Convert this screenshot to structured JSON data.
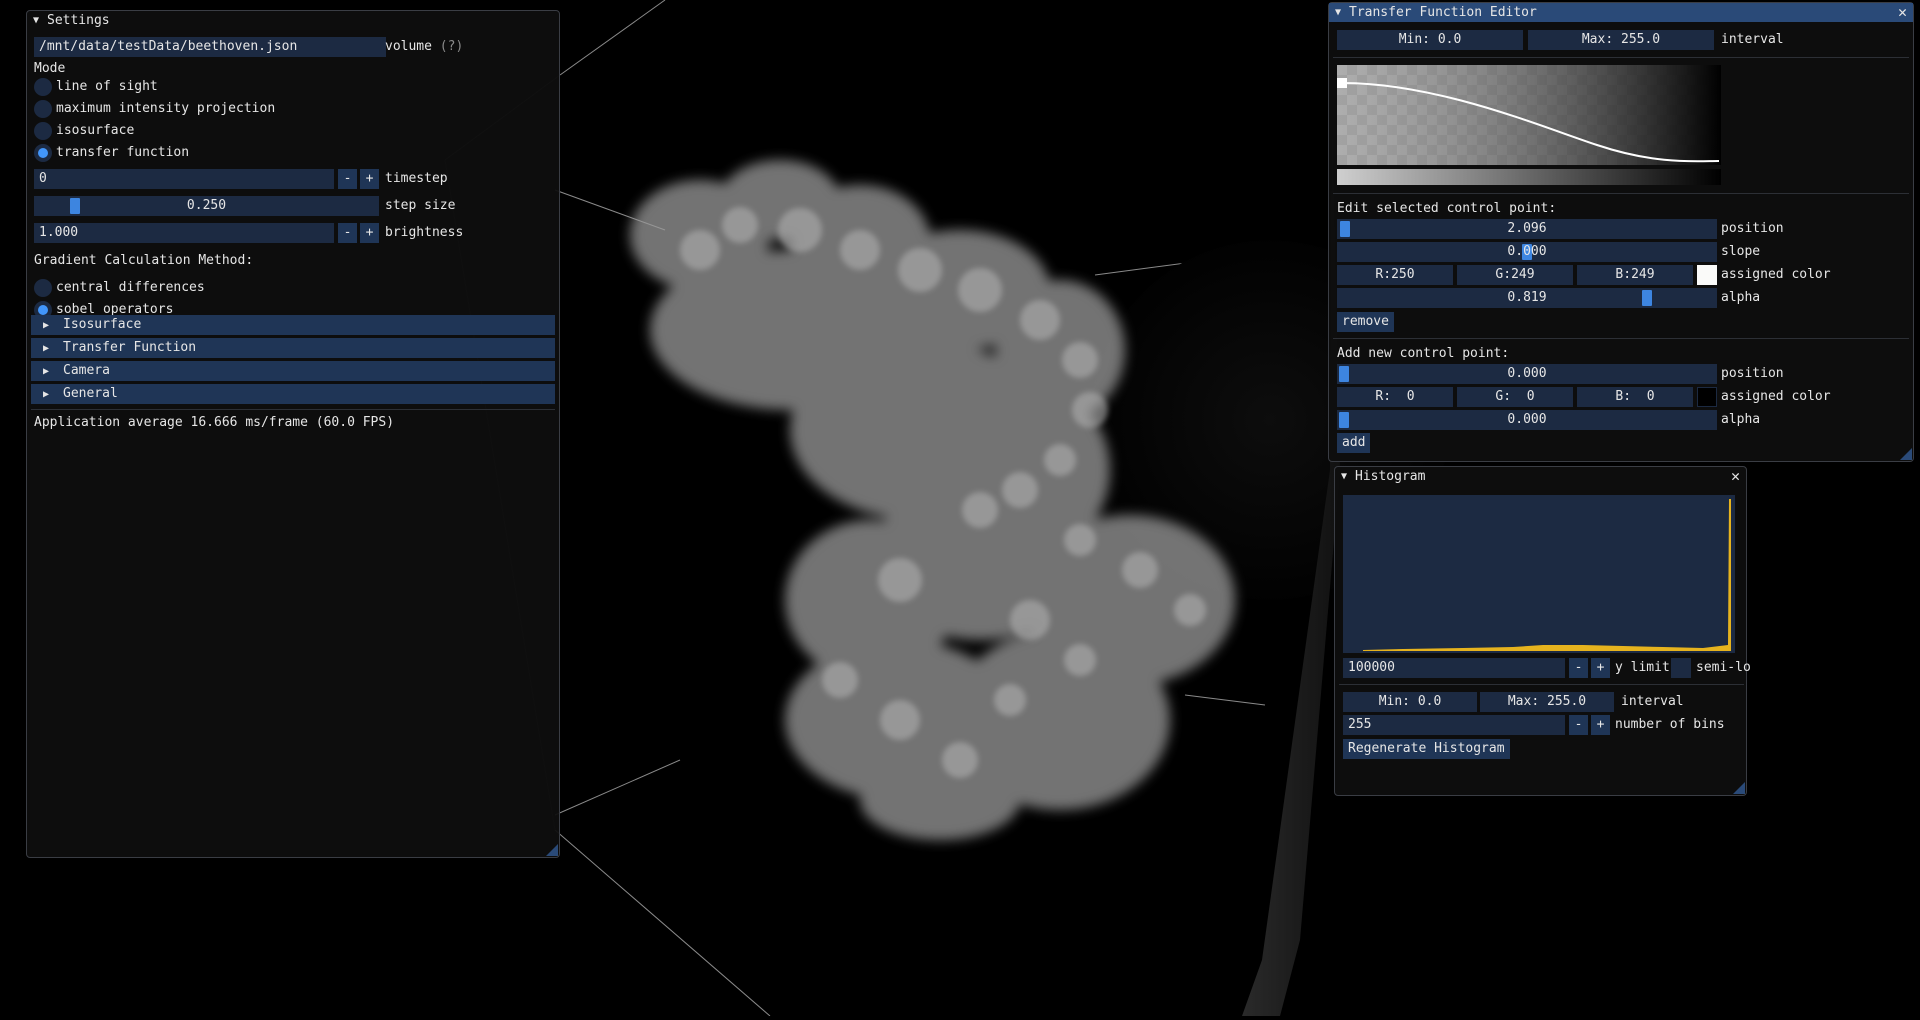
{
  "settings": {
    "title": "Settings",
    "volume_path": "/mnt/data/testData/beethoven.json",
    "volume_label": "volume",
    "volume_help": "(?)",
    "mode_label": "Mode",
    "modes": [
      {
        "label": "line of sight",
        "selected": false
      },
      {
        "label": "maximum intensity projection",
        "selected": false
      },
      {
        "label": "isosurface",
        "selected": false
      },
      {
        "label": "transfer function",
        "selected": true
      }
    ],
    "timestep_value": "0",
    "timestep_label": "timestep",
    "step_size_value": "0.250",
    "step_size_fraction": 0.08,
    "step_size_label": "step size",
    "brightness_value": "1.000",
    "brightness_label": "brightness",
    "minus": "-",
    "plus": "+",
    "gradient_label": "Gradient Calculation Method:",
    "gradient_methods": [
      {
        "label": "central differences",
        "selected": false
      },
      {
        "label": "sobel operators",
        "selected": true
      }
    ],
    "sections": [
      "Isosurface",
      "Transfer Function",
      "Camera",
      "General"
    ],
    "fps_text": "Application average 16.666 ms/frame (60.0 FPS)"
  },
  "tf_editor": {
    "title": "Transfer Function Editor",
    "min_text": "Min: 0.0",
    "max_text": "Max: 255.0",
    "interval_label": "interval",
    "edit_heading": "Edit selected control point:",
    "edit_position_value": "2.096",
    "edit_position_fraction": 0.008,
    "position_label": "position",
    "slope_value": "0.000",
    "slope_fraction": 0.5,
    "slope_label": "slope",
    "r_text": "R:250",
    "g_text": "G:249",
    "b_text": "B:249",
    "assigned_color_label": "assigned color",
    "edit_swatch": "#fafaf9",
    "alpha_value": "0.819",
    "alpha_fraction": 0.819,
    "alpha_label": "alpha",
    "remove_label": "remove",
    "add_heading": "Add new control point:",
    "add_position_value": "0.000",
    "add_r_text": "R:  0",
    "add_g_text": "G:  0",
    "add_b_text": "B:  0",
    "add_swatch": "#000000",
    "add_alpha_value": "0.000",
    "add_label": "add"
  },
  "histogram": {
    "title": "Histogram",
    "y_limit_value": "100000",
    "y_limit_label": "y limit",
    "semi_log_label": "semi-lo",
    "min_text": "Min: 0.0",
    "max_text": "Max: 255.0",
    "interval_label": "interval",
    "bins_value": "255",
    "bins_label": "number of bins",
    "regenerate_label": "Regenerate Histogram"
  },
  "colors": {
    "accent": "#4296fa",
    "title_active": "#2a4a78",
    "frame_bg": "#1c2a42",
    "button_bg": "#1f3556",
    "histogram_bar": "#e6b31e"
  }
}
